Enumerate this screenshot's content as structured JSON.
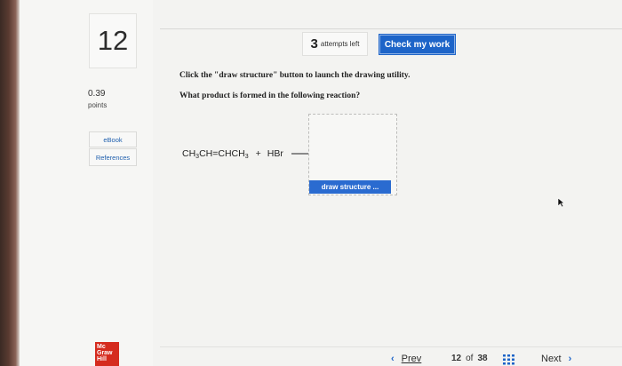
{
  "question": {
    "number": "12",
    "points_value": "0.39",
    "points_label": "points"
  },
  "sidebar": {
    "ebook_label": "eBook",
    "references_label": "References"
  },
  "header": {
    "attempts_count": "3",
    "attempts_text": "attempts left",
    "check_button_label": "Check my work"
  },
  "content": {
    "instruction": "Click the \"draw structure\" button to launch the drawing utility.",
    "question_text": "What product is formed in the following reaction?",
    "reaction": {
      "reactant_parts": [
        "CH",
        "3",
        "CH=CHCH",
        "3"
      ],
      "reagent": "HBr",
      "plus": "+"
    },
    "draw_button_label": "draw structure ..."
  },
  "footer": {
    "logo_lines": [
      "Mc",
      "Graw",
      "Hill"
    ],
    "prev_label": "Prev",
    "current_page": "12",
    "of_text": "of",
    "total_pages": "38",
    "next_label": "Next"
  },
  "colors": {
    "accent_blue": "#1d64c8",
    "logo_red": "#d52b1e"
  },
  "icons": [
    "chevron-left-icon",
    "grid-icon",
    "chevron-right-icon",
    "cursor-icon",
    "reaction-arrow-icon"
  ]
}
